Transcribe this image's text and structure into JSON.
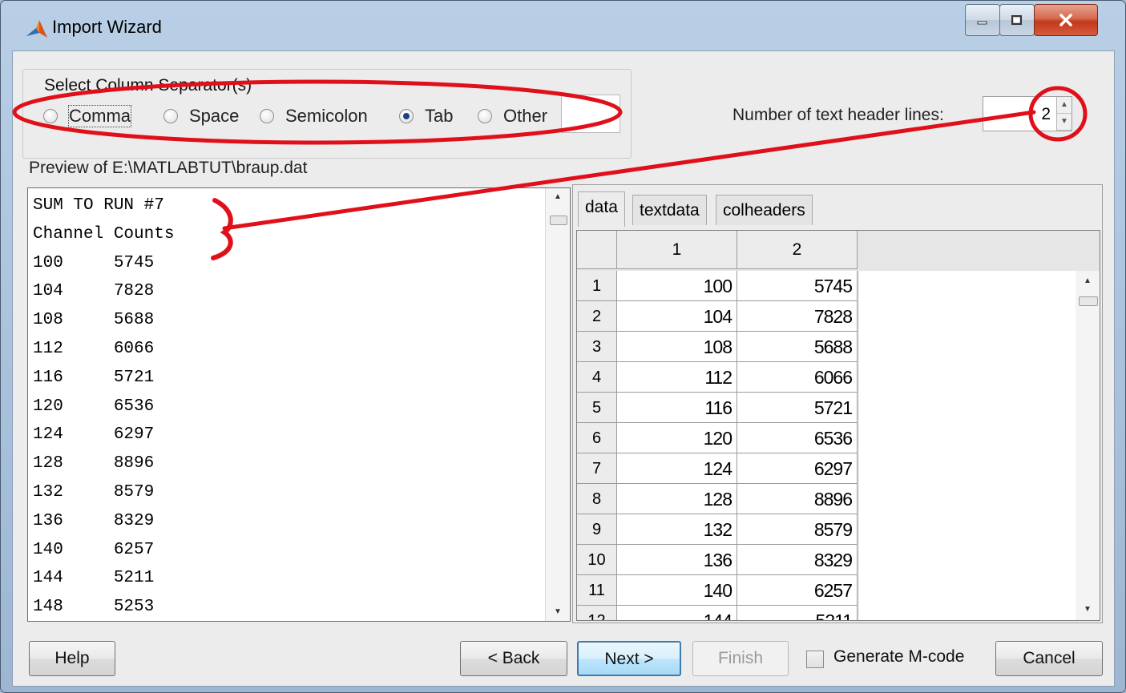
{
  "window": {
    "title": "Import Wizard"
  },
  "separators": {
    "group_label": "Select Column Separator(s)",
    "options": [
      {
        "label": "Comma",
        "selected": false
      },
      {
        "label": "Space",
        "selected": false
      },
      {
        "label": "Semicolon",
        "selected": false
      },
      {
        "label": "Tab",
        "selected": true
      },
      {
        "label": "Other",
        "selected": false
      }
    ]
  },
  "header_lines": {
    "label": "Number of text header lines:",
    "value": "2"
  },
  "preview": {
    "label": "Preview of E:\\MATLABTUT\\braup.dat",
    "lines": [
      "SUM TO RUN #7",
      "Channel Counts",
      "100     5745",
      "104     7828",
      "108     5688",
      "112     6066",
      "116     5721",
      "120     6536",
      "124     6297",
      "128     8896",
      "132     8579",
      "136     8329",
      "140     6257",
      "144     5211",
      "148     5253"
    ]
  },
  "tabs": [
    "data",
    "textdata",
    "colheaders"
  ],
  "grid": {
    "col_headers": [
      "1",
      "2"
    ],
    "rows": [
      {
        "row": "1",
        "c1": "100",
        "c2": "5745"
      },
      {
        "row": "2",
        "c1": "104",
        "c2": "7828"
      },
      {
        "row": "3",
        "c1": "108",
        "c2": "5688"
      },
      {
        "row": "4",
        "c1": "112",
        "c2": "6066"
      },
      {
        "row": "5",
        "c1": "116",
        "c2": "5721"
      },
      {
        "row": "6",
        "c1": "120",
        "c2": "6536"
      },
      {
        "row": "7",
        "c1": "124",
        "c2": "6297"
      },
      {
        "row": "8",
        "c1": "128",
        "c2": "8896"
      },
      {
        "row": "9",
        "c1": "132",
        "c2": "8579"
      },
      {
        "row": "10",
        "c1": "136",
        "c2": "8329"
      },
      {
        "row": "11",
        "c1": "140",
        "c2": "6257"
      },
      {
        "row": "12",
        "c1": "144",
        "c2": "5211"
      }
    ]
  },
  "buttons": {
    "help": "Help",
    "back": "< Back",
    "next": "Next >",
    "finish": "Finish",
    "generate": "Generate M-code",
    "cancel": "Cancel"
  },
  "icons": {
    "app": "matlab-logo-icon",
    "minimize": "minimize-icon",
    "maximize": "maximize-icon",
    "close": "close-icon"
  },
  "colors": {
    "annotation": "#e0101a",
    "default_button": "#3d7bad"
  }
}
